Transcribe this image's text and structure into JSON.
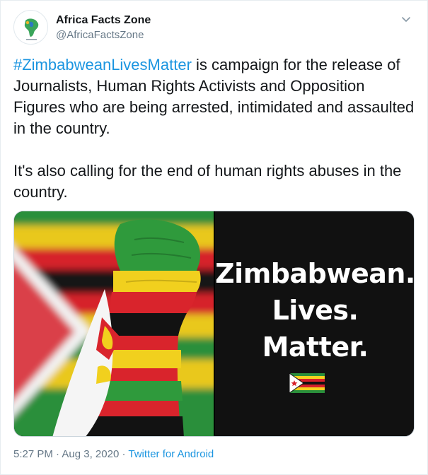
{
  "account": {
    "display_name": "Africa Facts Zone",
    "handle": "@AfricaFactsZone",
    "avatar_icon": "africa-map-logo-icon"
  },
  "tweet": {
    "hashtag": "#ZimbabweanLivesMatter",
    "paragraph1_rest": " is campaign for the release of Journalists, Human Rights Activists and Opposition Figures who are being arrested, intimidated and assaulted in the country.",
    "paragraph2": "It's also calling for the end of human rights abuses in the country."
  },
  "media": {
    "left_image": "fist-painted-zimbabwe-flag",
    "right_lines": [
      "Zimbabwean.",
      "Lives.",
      "Matter."
    ],
    "right_flag_icon": "zimbabwe-flag-icon"
  },
  "meta": {
    "time": "5:27 PM",
    "separator": " · ",
    "date": "Aug 3, 2020",
    "source": "Twitter for Android"
  },
  "colors": {
    "link": "#1b95e0",
    "text": "#14171a",
    "muted": "#657786",
    "zim_green": "#2a8f3a",
    "zim_yellow": "#f4d21f",
    "zim_red": "#d6202a",
    "zim_black": "#111111"
  }
}
